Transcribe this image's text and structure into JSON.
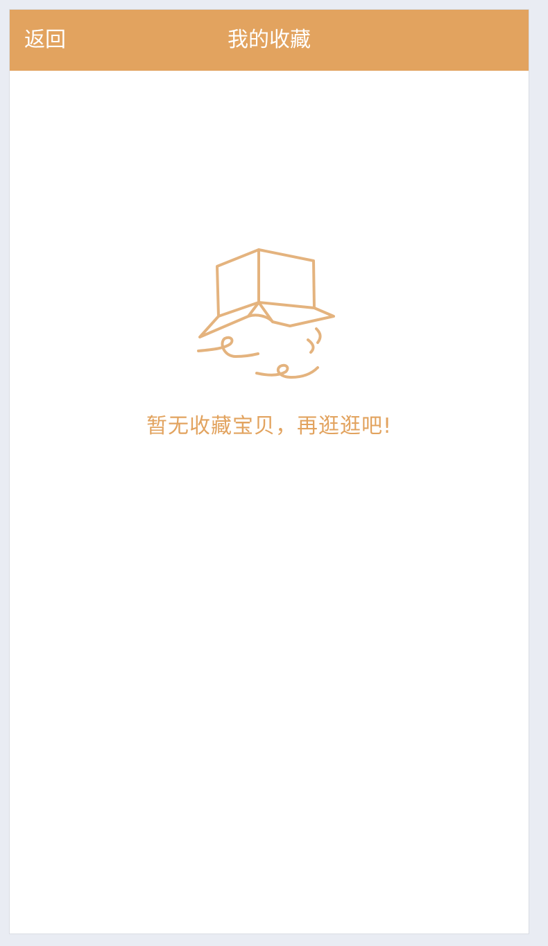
{
  "colors": {
    "accent": "#e2a35f",
    "icon_stroke": "#e4b37e",
    "background": "#e9ecf3"
  },
  "header": {
    "back_label": "返回",
    "title": "我的收藏"
  },
  "empty_state": {
    "icon": "empty-box-icon",
    "message": "暂无收藏宝贝，再逛逛吧!"
  }
}
